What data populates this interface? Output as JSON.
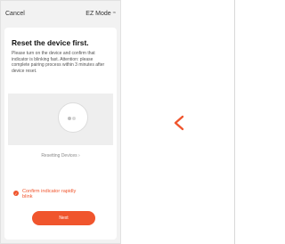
{
  "topbar": {
    "cancel_label": "Cancel",
    "mode_label": "EZ Mode",
    "mode_icon": "chevron-down-icon"
  },
  "card": {
    "title": "Reset the device first.",
    "description": "Please turn on the device and confirm that indicator is blinking fast. Attention: please complete pairing process within 3 minutes after device reset.",
    "resetting_link": "Resetting Devices ›",
    "confirm_label": "Confirm indicator rapidly blink",
    "confirm_checked": true,
    "next_label": "Next"
  },
  "nav": {
    "back_icon": "chevron-left-icon"
  },
  "colors": {
    "accent": "#f0552d",
    "panel_bg": "#f2f2f2",
    "device_area_bg": "#eeeeee"
  }
}
